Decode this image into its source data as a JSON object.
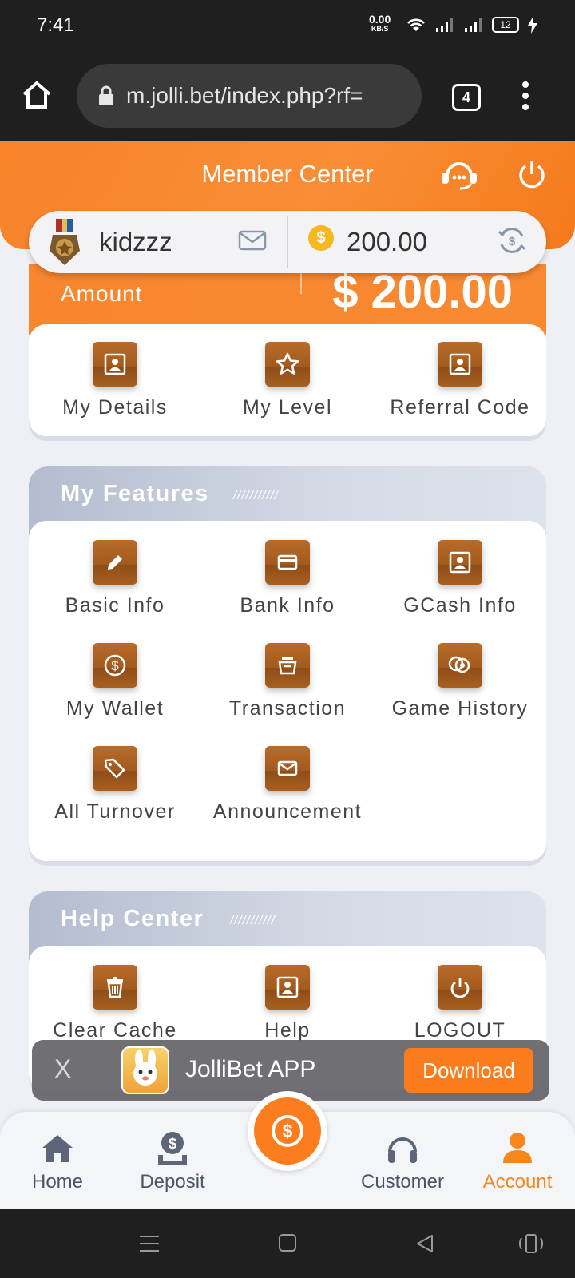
{
  "status_bar": {
    "time": "7:41",
    "net_speed": "0.00",
    "net_unit": "KB/S",
    "battery": "12"
  },
  "browser": {
    "url": "m.jolli.bet/index.php?rf=",
    "tab_count": "4"
  },
  "header": {
    "title": "Member Center"
  },
  "user": {
    "name": "kidzzz",
    "balance": "200.00"
  },
  "amount": {
    "label": "Amount",
    "value": "$ 200.00"
  },
  "profile_tiles": [
    {
      "label": "My Details",
      "icon": "id-card-icon"
    },
    {
      "label": "My Level",
      "icon": "star-icon"
    },
    {
      "label": "Referral Code",
      "icon": "id-card-icon"
    }
  ],
  "features": {
    "title": "My Features",
    "stripes": "///////////",
    "items": [
      {
        "label": "Basic Info",
        "icon": "pencil-icon"
      },
      {
        "label": "Bank Info",
        "icon": "card-icon"
      },
      {
        "label": "GCash Info",
        "icon": "id-card-icon"
      },
      {
        "label": "My Wallet",
        "icon": "dollar-coin-icon"
      },
      {
        "label": "Transaction",
        "icon": "basket-icon"
      },
      {
        "label": "Game History",
        "icon": "chips-icon"
      },
      {
        "label": "All Turnover",
        "icon": "tag-icon"
      },
      {
        "label": "Announcement",
        "icon": "mail-icon"
      }
    ]
  },
  "help": {
    "title": "Help Center",
    "stripes": "///////////",
    "items": [
      {
        "label": "Clear Cache",
        "icon": "trash-icon"
      },
      {
        "label": "Help",
        "icon": "id-card-icon"
      },
      {
        "label": "LOGOUT",
        "icon": "power-icon"
      }
    ]
  },
  "app_banner": {
    "close": "X",
    "name": "JolliBet APP",
    "download": "Download"
  },
  "bottom_nav": {
    "home": "Home",
    "deposit": "Deposit",
    "customer": "Customer",
    "account": "Account"
  },
  "colors": {
    "brand_orange": "#f7861d",
    "tile_brown": "#a35a1d"
  }
}
